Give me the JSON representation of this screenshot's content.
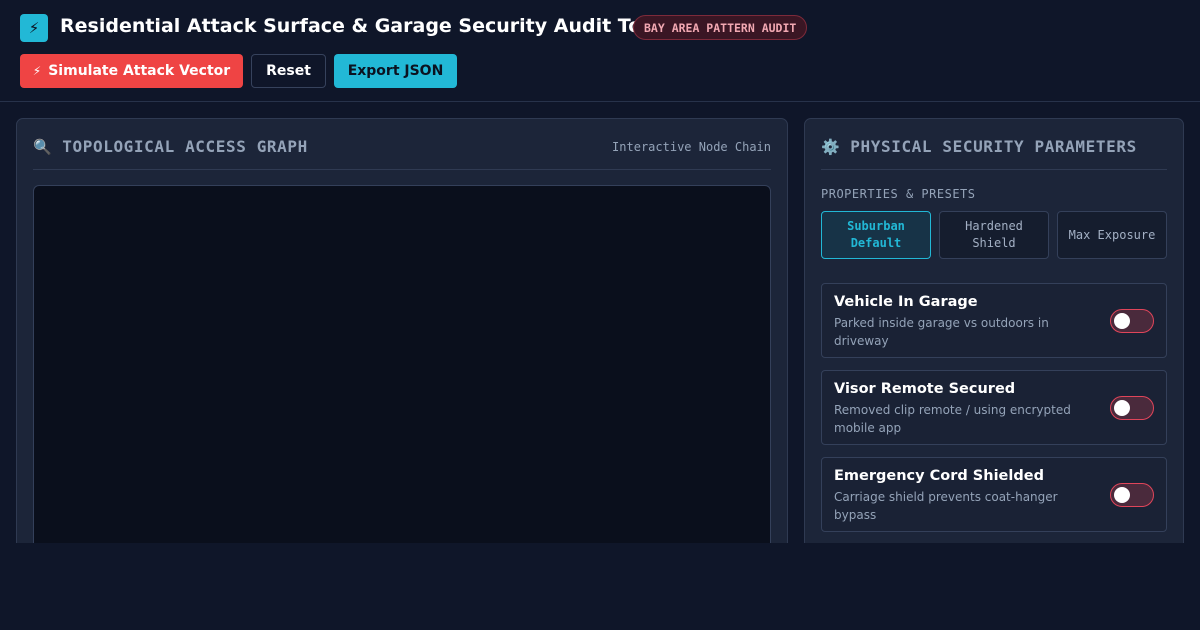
{
  "header": {
    "logo_glyph": "⚡",
    "title": "Residential Attack Surface & Garage Security Audit Tool",
    "badge": "BAY AREA PATTERN AUDIT"
  },
  "toolbar": {
    "simulate_icon": "⚡",
    "simulate_label": "Simulate Attack Vector",
    "reset_label": "Reset",
    "export_label": "Export JSON"
  },
  "graph_panel": {
    "icon": "🔍",
    "title": "TOPOLOGICAL ACCESS GRAPH",
    "subtitle": "Interactive Node Chain"
  },
  "params_panel": {
    "icon": "⚙️",
    "title": "PHYSICAL SECURITY PARAMETERS",
    "presets_label": "PROPERTIES & PRESETS",
    "presets": [
      {
        "label": "Suburban Default",
        "active": true
      },
      {
        "label": "Hardened Shield",
        "active": false
      },
      {
        "label": "Max Exposure",
        "active": false
      }
    ],
    "toggles": [
      {
        "title": "Vehicle In Garage",
        "description": "Parked inside garage vs outdoors in driveway",
        "enabled": false
      },
      {
        "title": "Visor Remote Secured",
        "description": "Removed clip remote / using encrypted mobile app",
        "enabled": false
      },
      {
        "title": "Emergency Cord Shielded",
        "description": "Carriage shield prevents coat-hanger bypass",
        "enabled": false
      }
    ]
  },
  "colors": {
    "background": "#0f1629",
    "panel": "#1c2539",
    "accent_cyan": "#22b8d6",
    "danger_red": "#ef4444",
    "badge_text": "#f2a8b2"
  }
}
